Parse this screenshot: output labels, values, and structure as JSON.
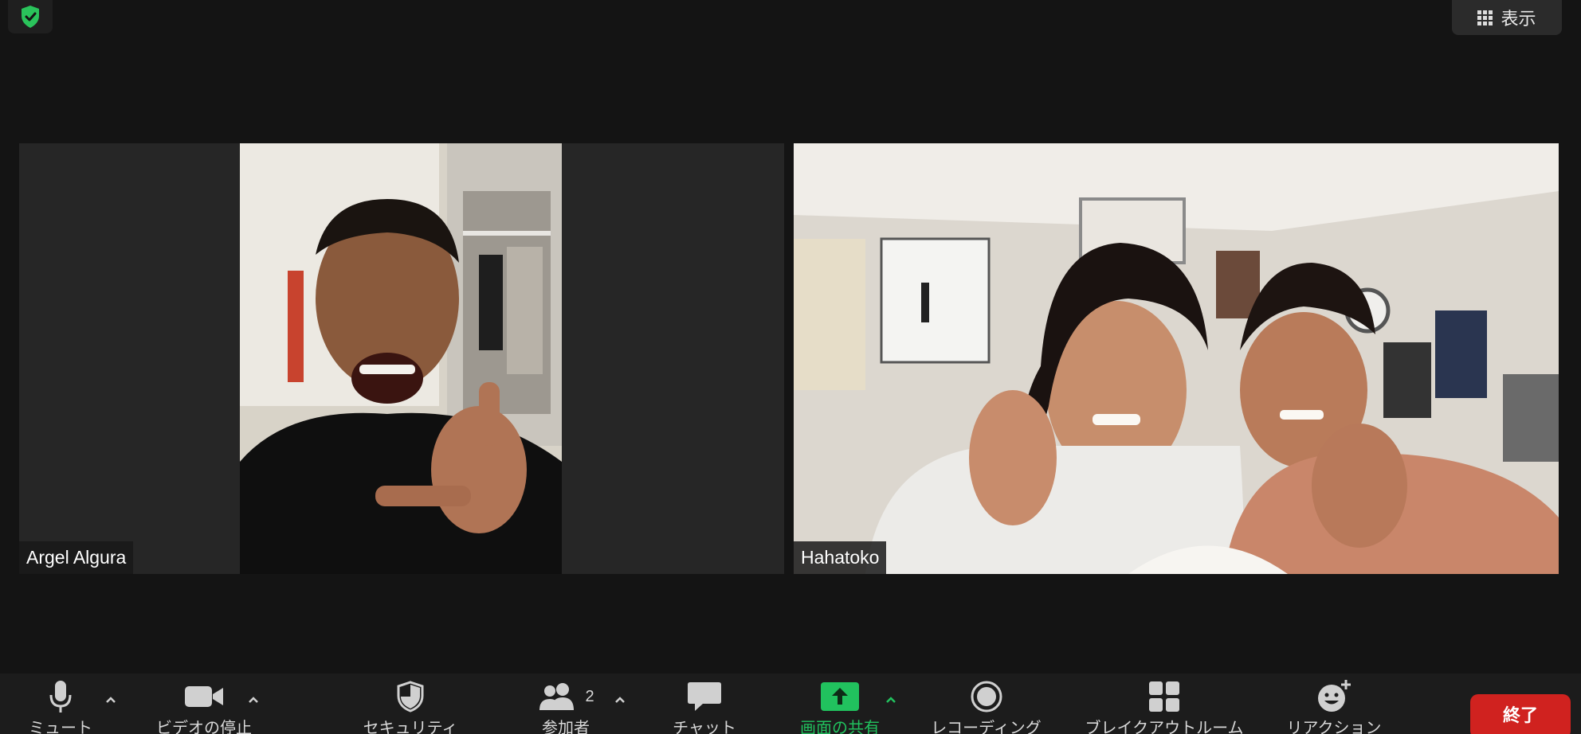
{
  "top_bar": {
    "view_label": "表示"
  },
  "participants": [
    {
      "name": "Argel Algura"
    },
    {
      "name": "Hahatoko"
    }
  ],
  "toolbar": {
    "mute_label": "ミュート",
    "video_label": "ビデオの停止",
    "security_label": "セキュリティ",
    "participants_label": "参加者",
    "participants_count": "2",
    "chat_label": "チャット",
    "share_label": "画面の共有",
    "record_label": "レコーディング",
    "breakout_label": "ブレイクアウトルーム",
    "reactions_label": "リアクション",
    "end_label": "終了"
  },
  "colors": {
    "share_green": "#21c25e",
    "end_red": "#d0221f",
    "secure_green": "#2ac35b"
  }
}
